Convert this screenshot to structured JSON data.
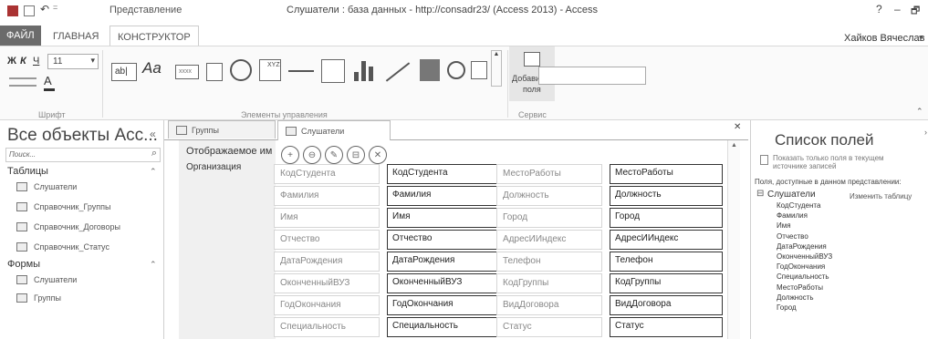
{
  "window": {
    "title": "Слушатели : база данных - http://consadr23/ (Access 2013) - Access",
    "context_tab_group": "Представление",
    "help": "?",
    "minimize": "–",
    "restore": "🗗",
    "user": "Хайков Вячеслав",
    "qat_separator": "⋮",
    "qat_arrow": "⇐"
  },
  "ribbon_tabs": {
    "file": "ФАЙЛ",
    "home": "ГЛАВНАЯ",
    "design": "КОНСТРУКТОР"
  },
  "ribbon": {
    "font_group": {
      "bold": "Ж",
      "italic": "К",
      "underline": "Ч",
      "size": "11",
      "label": "Шрифт"
    },
    "controls_group": {
      "label": "Элементы управления",
      "textbox": "ab|",
      "label_ctl": "Aa",
      "button_ctl": "xxxx"
    },
    "service_group": {
      "label": "Сервис",
      "add_fields_line1": "Добавить",
      "add_fields_line2": "поля"
    }
  },
  "nav_pane": {
    "title": "Все объекты Acc...",
    "search_placeholder": "Поиск...",
    "groups": [
      {
        "label": "Таблицы",
        "items": [
          "Слушатели",
          "Справочник_Группы",
          "Справочник_Договоры",
          "Справочник_Статус"
        ]
      },
      {
        "label": "Формы",
        "items": [
          "Слушатели",
          "Группы"
        ]
      }
    ]
  },
  "doc_tabs": [
    "Группы",
    "Слушатели"
  ],
  "form": {
    "left_labels": [
      "Отображаемое им",
      "Организация"
    ],
    "action_icons": [
      "+",
      "⊖",
      "✎",
      "⊟",
      "✕"
    ],
    "fields_left": [
      {
        "label": "КодСтудента",
        "value": "КодСтудента"
      },
      {
        "label": "Фамилия",
        "value": "Фамилия"
      },
      {
        "label": "Имя",
        "value": "Имя"
      },
      {
        "label": "Отчество",
        "value": "Отчество"
      },
      {
        "label": "ДатаРождения",
        "value": "ДатаРождения"
      },
      {
        "label": "ОконченныйВУЗ",
        "value": "ОконченныйВУЗ"
      },
      {
        "label": "ГодОкончания",
        "value": "ГодОкончания"
      },
      {
        "label": "Специальность",
        "value": "Специальность"
      }
    ],
    "fields_right": [
      {
        "label": "МестоРаботы",
        "value": "МестоРаботы"
      },
      {
        "label": "Должность",
        "value": "Должность"
      },
      {
        "label": "Город",
        "value": "Город"
      },
      {
        "label": "АдресИИндекс",
        "value": "АдресИИндекс"
      },
      {
        "label": "Телефон",
        "value": "Телефон"
      },
      {
        "label": "КодГруппы",
        "value": "КодГруппы"
      },
      {
        "label": "ВидДоговора",
        "value": "ВидДоговора"
      },
      {
        "label": "Статус",
        "value": "Статус"
      }
    ]
  },
  "field_list": {
    "title": "Список полей",
    "checkbox_label_line1": "Показать только поля в текущем",
    "checkbox_label_line2": "источнике записей",
    "available_label": "Поля, доступные в данном представлении:",
    "table_name": "Слушатели",
    "edit_table": "Изменить таблицу",
    "fields": [
      "КодСтудента",
      "Фамилия",
      "Имя",
      "Отчество",
      "ДатаРождения",
      "ОконченныйВУЗ",
      "ГодОкончания",
      "Специальность",
      "МестоРаботы",
      "Должность",
      "Город"
    ]
  },
  "icons": {
    "close": "✕",
    "collapse": "«",
    "search": "⌕",
    "chevron_up": "⌃",
    "scroll_up": "▲",
    "dropdown": "▾",
    "qat_dropdown": "=",
    "tree_toggle": "⊟"
  }
}
